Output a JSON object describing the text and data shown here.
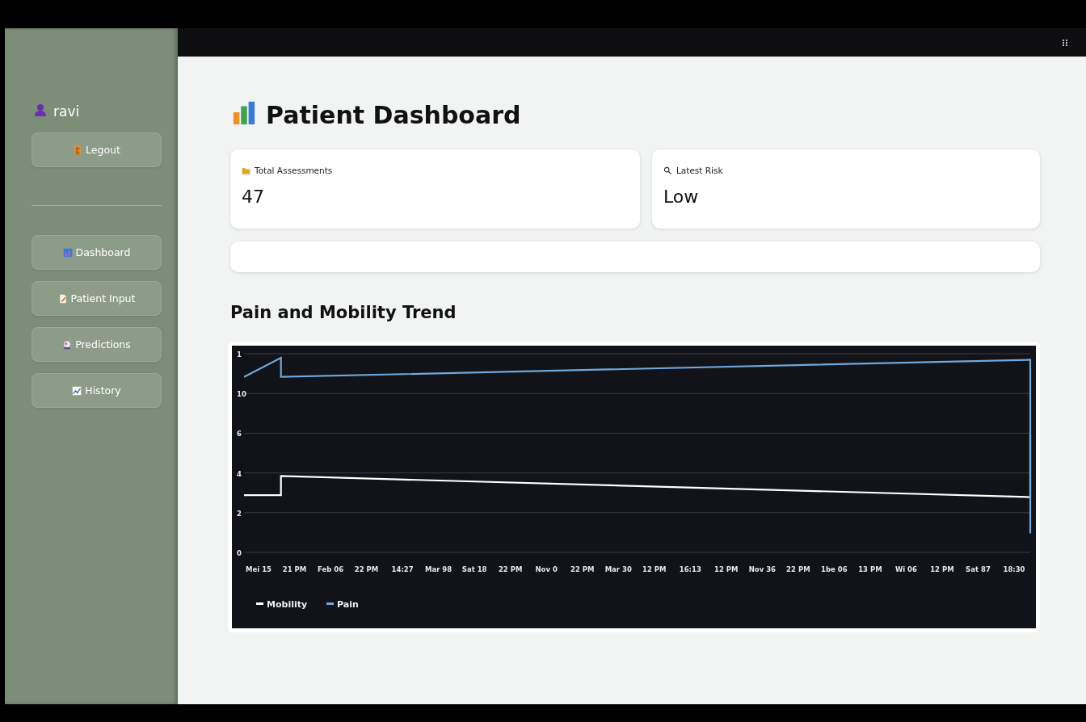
{
  "sidebar": {
    "user": {
      "name": "ravi"
    },
    "logout": {
      "label": "Legout"
    },
    "nav": [
      {
        "label": "Dashboard"
      },
      {
        "label": "Patient Input"
      },
      {
        "label": "Predictions"
      },
      {
        "label": "History"
      }
    ]
  },
  "page": {
    "title": "Patient Dashboard",
    "metrics": [
      {
        "label": "Total Assessments",
        "value": "47"
      },
      {
        "label": "Latest Risk",
        "value": "Low"
      }
    ],
    "chart_heading": "Pain and Mobility Trend",
    "chart": {
      "y_labels": [
        "1",
        "10",
        "6",
        "4",
        "2",
        "0"
      ],
      "x_labels": [
        "Mei 15",
        "21 PM",
        "Feb 06",
        "22 PM",
        "14:27",
        "Mar 98",
        "Sat 18",
        "22 PM",
        "Nov 0",
        "22 PM",
        "Mar 30",
        "12 PM",
        "16:13",
        "12 PM",
        "Nov 36",
        "22 PM",
        "1be 06",
        "13 PM",
        "Wi 06",
        "12 PM",
        "Sat 87",
        "18:30"
      ],
      "series": [
        {
          "name": "Mobility",
          "color": "#ffffff"
        },
        {
          "name": "Pain",
          "color": "#6fa8dc"
        }
      ]
    }
  }
}
